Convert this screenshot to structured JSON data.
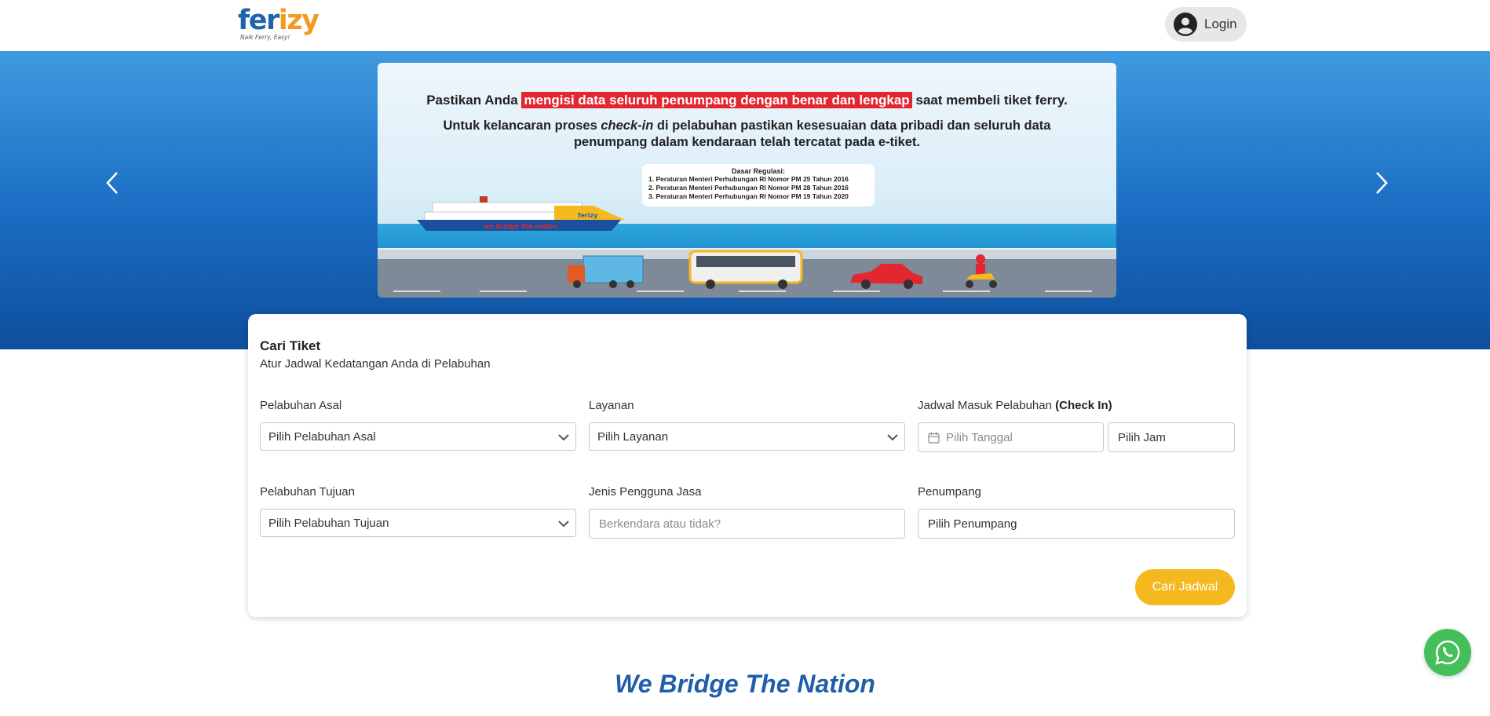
{
  "header": {
    "logo": {
      "part1": "fer",
      "part2": "izy",
      "tagline": "Naik Ferry, Easy!"
    },
    "login_label": "Login"
  },
  "banner": {
    "line1_before": "Pastikan Anda",
    "line1_highlight": "mengisi data seluruh penumpang dengan benar dan lengkap",
    "line1_after": "saat membeli tiket ferry.",
    "line2_before": "Untuk kelancaran proses",
    "line2_italic": "check-in",
    "line2_after": "di pelabuhan pastikan kesesuaian data pribadi dan seluruh data penumpang dalam kendaraan telah tercatat pada e-tiket.",
    "regulation_title": "Dasar Regulasi:",
    "regulations": [
      "1. Peraturan Menteri Perhubungan RI Nomor PM 25 Tahun 2016",
      "2. Peraturan Menteri Perhubungan RI Nomor PM 28 Tahun 2016",
      "3. Peraturan Menteri Perhubungan RI Nomor PM 19 Tahun 2020"
    ],
    "ship_slogan": "we bridge the nation",
    "ship_brand": "ferizy"
  },
  "search": {
    "title": "Cari Tiket",
    "subtitle": "Atur Jadwal Kedatangan Anda di Pelabuhan",
    "origin": {
      "label": "Pelabuhan Asal",
      "value": "Pilih Pelabuhan Asal"
    },
    "service": {
      "label": "Layanan",
      "value": "Pilih Layanan"
    },
    "schedule": {
      "label": "Jadwal Masuk Pelabuhan",
      "label_bold": "(Check In)",
      "date_placeholder": "Pilih Tanggal",
      "time_value": "Pilih Jam"
    },
    "destination": {
      "label": "Pelabuhan Tujuan",
      "value": "Pilih Pelabuhan Tujuan"
    },
    "user_type": {
      "label": "Jenis Pengguna Jasa",
      "placeholder": "Berkendara atau tidak?"
    },
    "passenger": {
      "label": "Penumpang",
      "value": "Pilih Penumpang"
    },
    "submit_label": "Cari Jadwal"
  },
  "tagline": "We Bridge The Nation",
  "icons": {
    "login": "user-circle-icon",
    "prev": "chevron-left-icon",
    "next": "chevron-right-icon",
    "select": "chevron-down-icon",
    "date": "calendar-icon",
    "whatsapp": "whatsapp-icon"
  },
  "colors": {
    "brand_blue": "#1d63ad",
    "brand_orange": "#f39a1f",
    "button_yellow": "#f5b81e",
    "whatsapp_green": "#45bf5a",
    "highlight_red": "#e32630"
  }
}
